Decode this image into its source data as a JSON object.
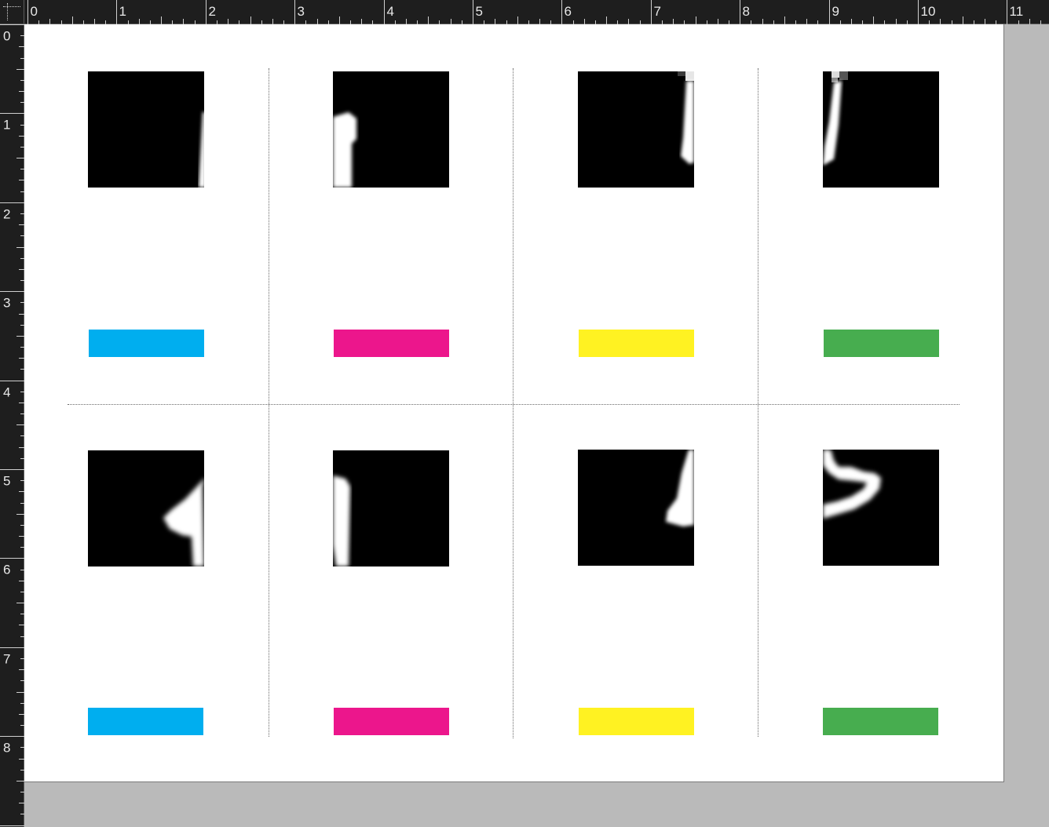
{
  "rulers": {
    "top_labels": [
      "0",
      "1",
      "2",
      "3",
      "4",
      "5",
      "6",
      "7",
      "8",
      "9",
      "10",
      "11"
    ],
    "left_labels": [
      "0",
      "1",
      "2",
      "3",
      "4",
      "5",
      "6",
      "7",
      "8"
    ],
    "units": "inches"
  },
  "canvas": {
    "background": "#ffffff",
    "rows": [
      {
        "cells": [
          {
            "image": "digit-fragment-right-edge-stroke",
            "swatch_color": "#00aeef"
          },
          {
            "image": "digit-fragment-left-edge-one",
            "swatch_color": "#ec168c"
          },
          {
            "image": "digit-fragment-right-vertical-stroke",
            "swatch_color": "#fff222"
          },
          {
            "image": "digit-fragment-left-vertical-stroke",
            "swatch_color": "#47ad4f"
          }
        ]
      },
      {
        "cells": [
          {
            "image": "digit-fragment-one-with-hook",
            "swatch_color": "#00aeef"
          },
          {
            "image": "digit-fragment-left-edge-one",
            "swatch_color": "#ec168c"
          },
          {
            "image": "digit-fragment-right-slanted-stroke",
            "swatch_color": "#fff222"
          },
          {
            "image": "digit-fragment-curved-stroke",
            "swatch_color": "#47ad4f"
          }
        ]
      }
    ]
  },
  "colors": {
    "cyan": "#00aeef",
    "magenta": "#ec168c",
    "yellow": "#fff222",
    "green": "#47ad4f",
    "workspace": "#bababa",
    "ruler": "#1e1e1e"
  }
}
